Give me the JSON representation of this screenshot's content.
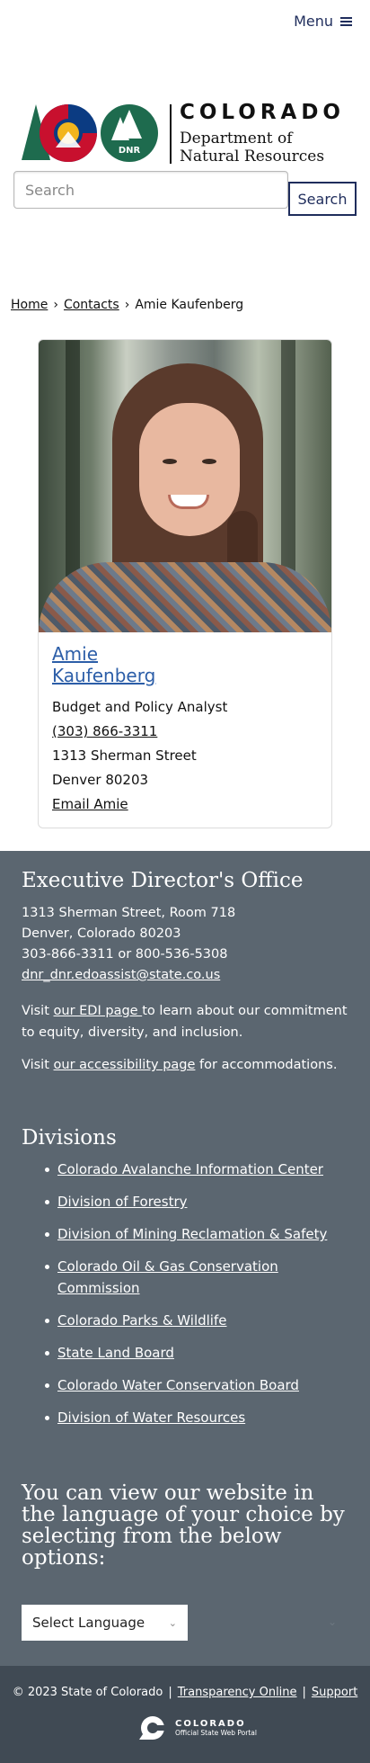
{
  "header": {
    "menu_label": "Menu",
    "logo": {
      "state_word": "COLORADO",
      "dept_line1": "Department of",
      "dept_line2": "Natural Resources",
      "badge_text": "DNR"
    },
    "search": {
      "placeholder": "Search",
      "button_label": "Search"
    }
  },
  "breadcrumb": {
    "items": [
      "Home",
      "Contacts"
    ],
    "current": "Amie Kaufenberg"
  },
  "contact_card": {
    "name": "Amie Kaufenberg",
    "title": "Budget and Policy Analyst",
    "phone": "(303) 866-3311",
    "address_line1": "1313 Sherman Street",
    "address_line2": "Denver 80203",
    "email_label": "Email Amie"
  },
  "footer": {
    "office": {
      "title": "Executive Director's Office",
      "address_line1": "1313 Sherman Street, Room 718",
      "address_line2": "Denver, Colorado 80203",
      "phone": "303-866-3311 or 800-536-5308",
      "email": "dnr_dnr.edoassist@state.co.us"
    },
    "edi": {
      "prefix": "Visit ",
      "link": "our EDI page ",
      "suffix": "to learn about our commitment to equity, diversity, and inclusion."
    },
    "accessibility": {
      "prefix": "Visit ",
      "link": "our accessibility page",
      "suffix": " for accommodations."
    },
    "divisions_title": "Divisions",
    "divisions": [
      "Colorado Avalanche Information Center",
      "Division of Forestry",
      "Division of Mining Reclamation & Safety",
      "Colorado Oil & Gas Conservation Commission",
      "Colorado Parks & Wildlife",
      "State Land Board",
      "Colorado Water Conservation Board",
      "Division of Water Resources"
    ],
    "language_heading": "You can view our website in the language of your choice by selecting from the below options:",
    "language_select": "Select Language"
  },
  "bottom_bar": {
    "copyright": "© 2023 State of Colorado",
    "links": [
      "Transparency Online",
      "Support"
    ],
    "portal_line1": "COLORADO",
    "portal_line2": "Official State Web Portal"
  },
  "colors": {
    "navy": "#1f2d5c",
    "link_blue": "#2c5ea8",
    "footer_bg": "#5b6670",
    "bottom_bg": "#404a54",
    "co_red": "#c8102e",
    "co_blue": "#0b3b82",
    "co_gold": "#f2b51d",
    "dnr_green": "#1e6b4e"
  }
}
